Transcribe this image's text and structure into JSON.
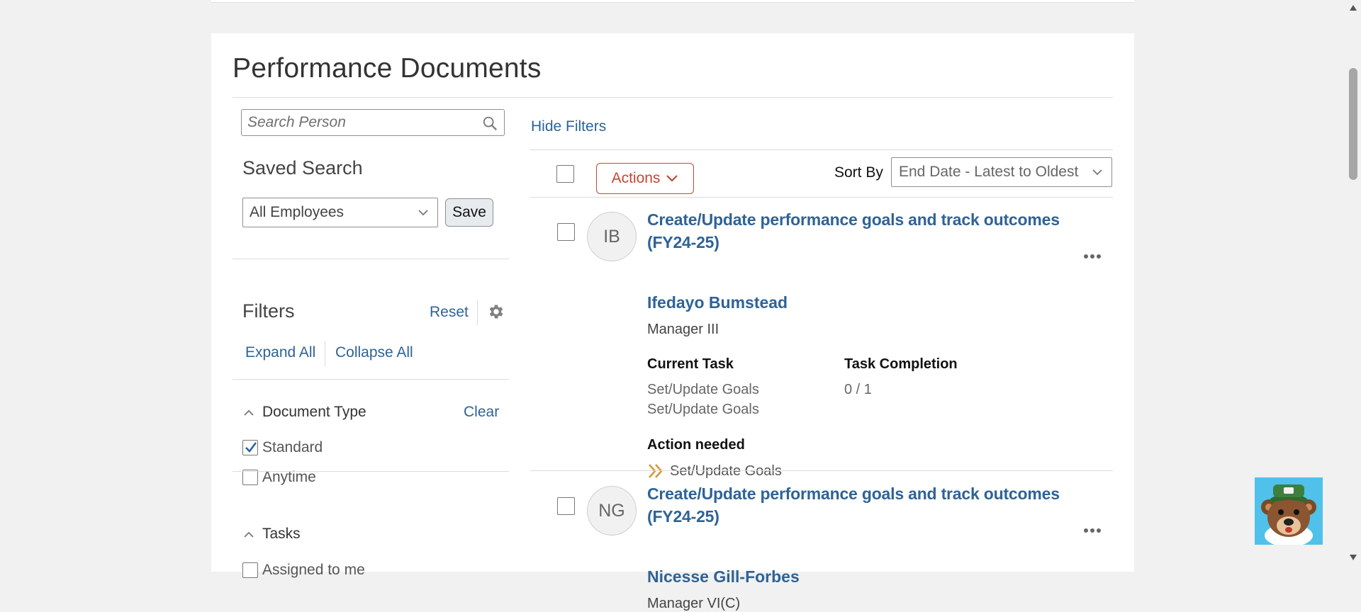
{
  "page": {
    "title": "Performance Documents"
  },
  "search": {
    "placeholder": "Search Person",
    "icon": "magnifier"
  },
  "filters_panel": {
    "hide_filters_label": "Hide Filters",
    "saved_search_label": "Saved Search",
    "saved_search_value": "All Employees",
    "save_label": "Save",
    "filters_label": "Filters",
    "reset_label": "Reset",
    "expand_all_label": "Expand All",
    "collapse_all_label": "Collapse All",
    "document_type": {
      "label": "Document Type",
      "clear_label": "Clear",
      "options": [
        {
          "label": "Standard",
          "checked": true
        },
        {
          "label": "Anytime",
          "checked": false
        }
      ]
    },
    "tasks": {
      "label": "Tasks",
      "options": [
        {
          "label": "Assigned to me",
          "checked": false
        }
      ]
    }
  },
  "toolbar": {
    "actions_label": "Actions",
    "sort_by_label": "Sort By",
    "sort_value": "End Date - Latest to Oldest"
  },
  "documents": [
    {
      "initials": "IB",
      "title": "Create/Update performance goals and track outcomes (FY24-25)",
      "person": "Ifedayo Bumstead",
      "job": "Manager III",
      "current_task_label": "Current Task",
      "current_tasks": [
        "Set/Update Goals",
        "Set/Update Goals"
      ],
      "task_completion_label": "Task Completion",
      "task_completion": "0 / 1",
      "action_needed_label": "Action needed",
      "action_needed": "Set/Update Goals"
    },
    {
      "initials": "NG",
      "title": "Create/Update performance goals and track outcomes (FY24-25)",
      "person": "Nicesse Gill-Forbes",
      "job": "Manager VI(C)"
    }
  ],
  "colors": {
    "link": "#2e6396",
    "actions_accent": "#c74634",
    "action_chevron": "#d19a3a",
    "mascot_background": "#4fc1ea"
  }
}
